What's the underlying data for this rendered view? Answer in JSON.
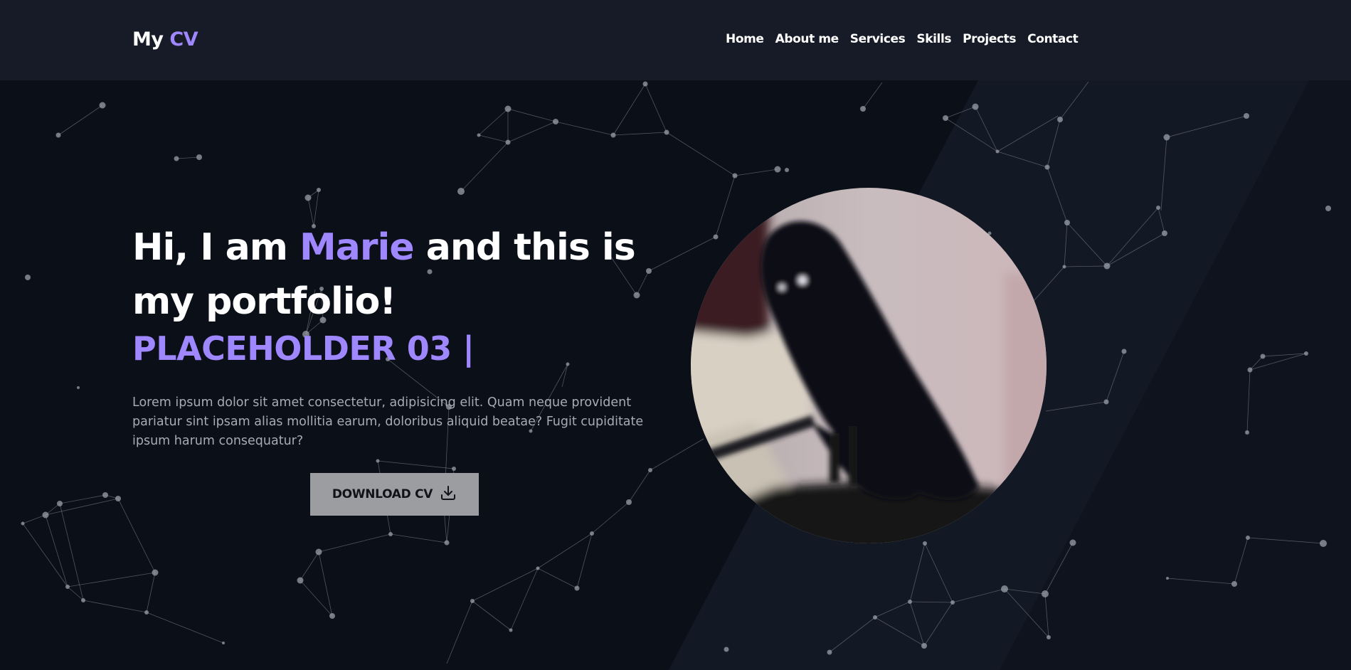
{
  "header": {
    "logo_prefix": "My",
    "logo_accent": "CV",
    "nav": [
      "Home",
      "About me",
      "Services",
      "Skills",
      "Projects",
      "Contact"
    ]
  },
  "hero": {
    "title_before": "Hi, I am",
    "title_name": "Marie",
    "title_after": "and this is my portfolio!",
    "typed_text": "PLACEHOLDER 03 |",
    "description": "Lorem ipsum dolor sit amet consectetur, adipisicing elit. Quam neque provident pariatur sint ipsam alias mollitia earum, doloribus aliquid beatae? Fugit cupiditate ipsum harum consequatur?",
    "button_label": "DOWNLOAD CV",
    "button_icon": "download-icon",
    "photo": "crow-photo"
  },
  "colors": {
    "background": "#0a0f18",
    "header_bg": "#161b27",
    "accent": "#9f87ff",
    "button_bg": "#9b9da1",
    "text_muted": "#a7abb5"
  }
}
